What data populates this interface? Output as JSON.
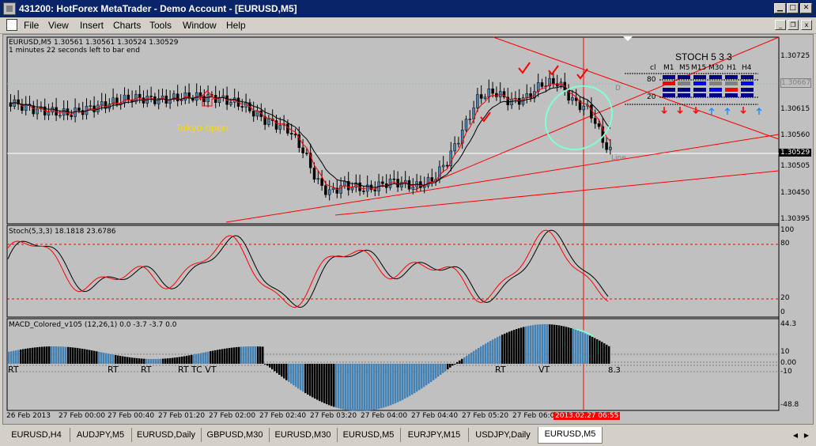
{
  "window": {
    "title": "431200: HotForex MetaTrader - Demo Account - [EURUSD,M5]",
    "minimize": "▁",
    "maximize": "□",
    "close": "✕"
  },
  "menu": [
    "File",
    "View",
    "Insert",
    "Charts",
    "Tools",
    "Window",
    "Help"
  ],
  "mdi": {
    "minimize": "_",
    "restore": "❐",
    "close": "x"
  },
  "chart": {
    "header": "EURUSD,M5  1.30561 1.30561 1.30524 1.30529",
    "timer": "1 minutes 22 seconds left to bar end",
    "tokyo_label": "Tokyo open",
    "line_label": "Line",
    "d_label": "D",
    "current_price": "1.30529",
    "dotted_price": "1.30667",
    "price_ticks": [
      "1.30725",
      "1.30670",
      "1.30615",
      "1.30560",
      "1.30505",
      "1.30450",
      "1.30395"
    ],
    "time_ticks": [
      "26 Feb 2013",
      "27 Feb 00:00",
      "27 Feb 00:40",
      "27 Feb 01:20",
      "27 Feb 02:00",
      "27 Feb 02:40",
      "27 Feb 03:20",
      "27 Feb 04:00",
      "27 Feb 04:40",
      "27 Feb 05:20",
      "27 Feb 06:0"
    ],
    "crosshair_time": "2013.02.27 06:55",
    "colors": {
      "background": "#c0c0c0",
      "bull_candle": "#4682b4",
      "bear_candle": "#000000",
      "trendline": "#ff0000",
      "signal": "#ff0000",
      "annotation_ellipse": "#7fffd4",
      "tokyo_text": "#ffd700"
    }
  },
  "stoch_panel": {
    "title": "STOCH  5 3 3",
    "level_80": "80",
    "level_20": "20",
    "cl_label": "cl",
    "timeframes": [
      "M1",
      "M5",
      "M15",
      "M30",
      "H1",
      "H4"
    ],
    "arrows": [
      "down",
      "down",
      "down",
      "up",
      "up",
      "down",
      "up"
    ]
  },
  "stoch": {
    "header": "Stoch(5,3,3) 18.1818 23.6786",
    "ticks": [
      "100",
      "80",
      "20",
      "0"
    ]
  },
  "macd": {
    "header": "MACD_Colored_v105 (12,26,1) 0.0 -3.7 -3.7 0.0",
    "ticks": [
      "44.3",
      "10",
      "0.00",
      "-10",
      "-48.8"
    ],
    "labels": [
      "RT",
      "RT",
      "RT",
      "RT TC VT",
      "RT",
      "VT",
      "8.3"
    ]
  },
  "tabs": [
    "EURUSD,H4",
    "AUDJPY,M5",
    "EURUSD,Daily",
    "GBPUSD,M30",
    "EURUSD,M30",
    "EURUSD,M5",
    "EURJPY,M15",
    "USDJPY,Daily",
    "EURUSD,M5"
  ],
  "active_tab": 8
}
